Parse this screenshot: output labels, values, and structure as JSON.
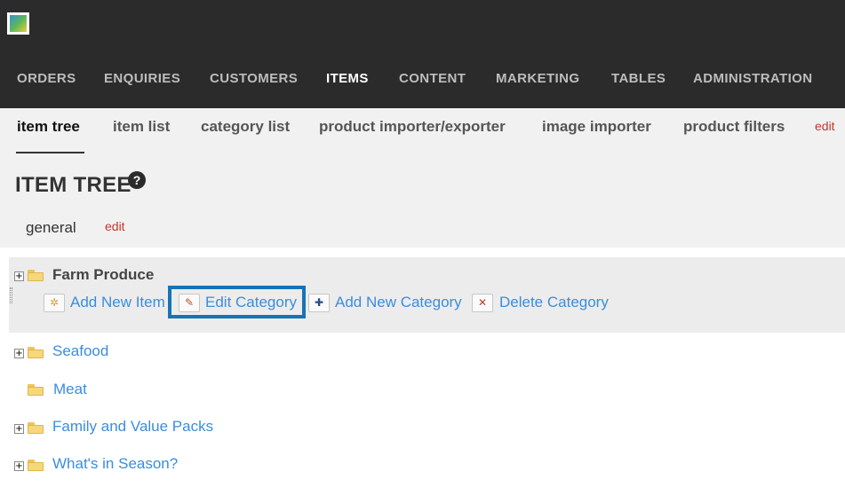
{
  "header": {
    "logo_icon": "site-logo-icon"
  },
  "main_nav": {
    "items": [
      {
        "label": "ORDERS"
      },
      {
        "label": "ENQUIRIES"
      },
      {
        "label": "CUSTOMERS"
      },
      {
        "label": "ITEMS"
      },
      {
        "label": "CONTENT"
      },
      {
        "label": "MARKETING"
      },
      {
        "label": "TABLES"
      },
      {
        "label": "ADMINISTRATION"
      }
    ],
    "active": "ITEMS"
  },
  "sub_nav": {
    "items": [
      {
        "label": "item tree"
      },
      {
        "label": "item list"
      },
      {
        "label": "category list"
      },
      {
        "label": "product importer/exporter"
      },
      {
        "label": "image importer"
      },
      {
        "label": "product filters"
      }
    ],
    "active": "item tree",
    "edit_label": "edit"
  },
  "page": {
    "title": "ITEM TREE",
    "help_glyph": "?",
    "general_tab": "general",
    "general_edit": "edit"
  },
  "tree": {
    "selected": {
      "label": "Farm Produce",
      "expander": "+",
      "actions": [
        {
          "label": "Add New Item",
          "icon": "add-item-icon",
          "glyph": "✲"
        },
        {
          "label": "Edit Category",
          "icon": "pencil-icon",
          "glyph": "✎"
        },
        {
          "label": "Add New Category",
          "icon": "plus-icon",
          "glyph": "✚"
        },
        {
          "label": "Delete Category",
          "icon": "delete-x-icon",
          "glyph": "✕"
        }
      ]
    },
    "nodes": [
      {
        "label": "Seafood",
        "expander": "+"
      },
      {
        "label": "Meat"
      },
      {
        "label": "Family and Value Packs",
        "expander": "+"
      },
      {
        "label": "What's in Season?",
        "expander": "+"
      }
    ]
  },
  "colors": {
    "topbar": "#2b2b2b",
    "link": "#3a8dde",
    "edit_red": "#c0392b",
    "highlight": "#1673b8"
  }
}
